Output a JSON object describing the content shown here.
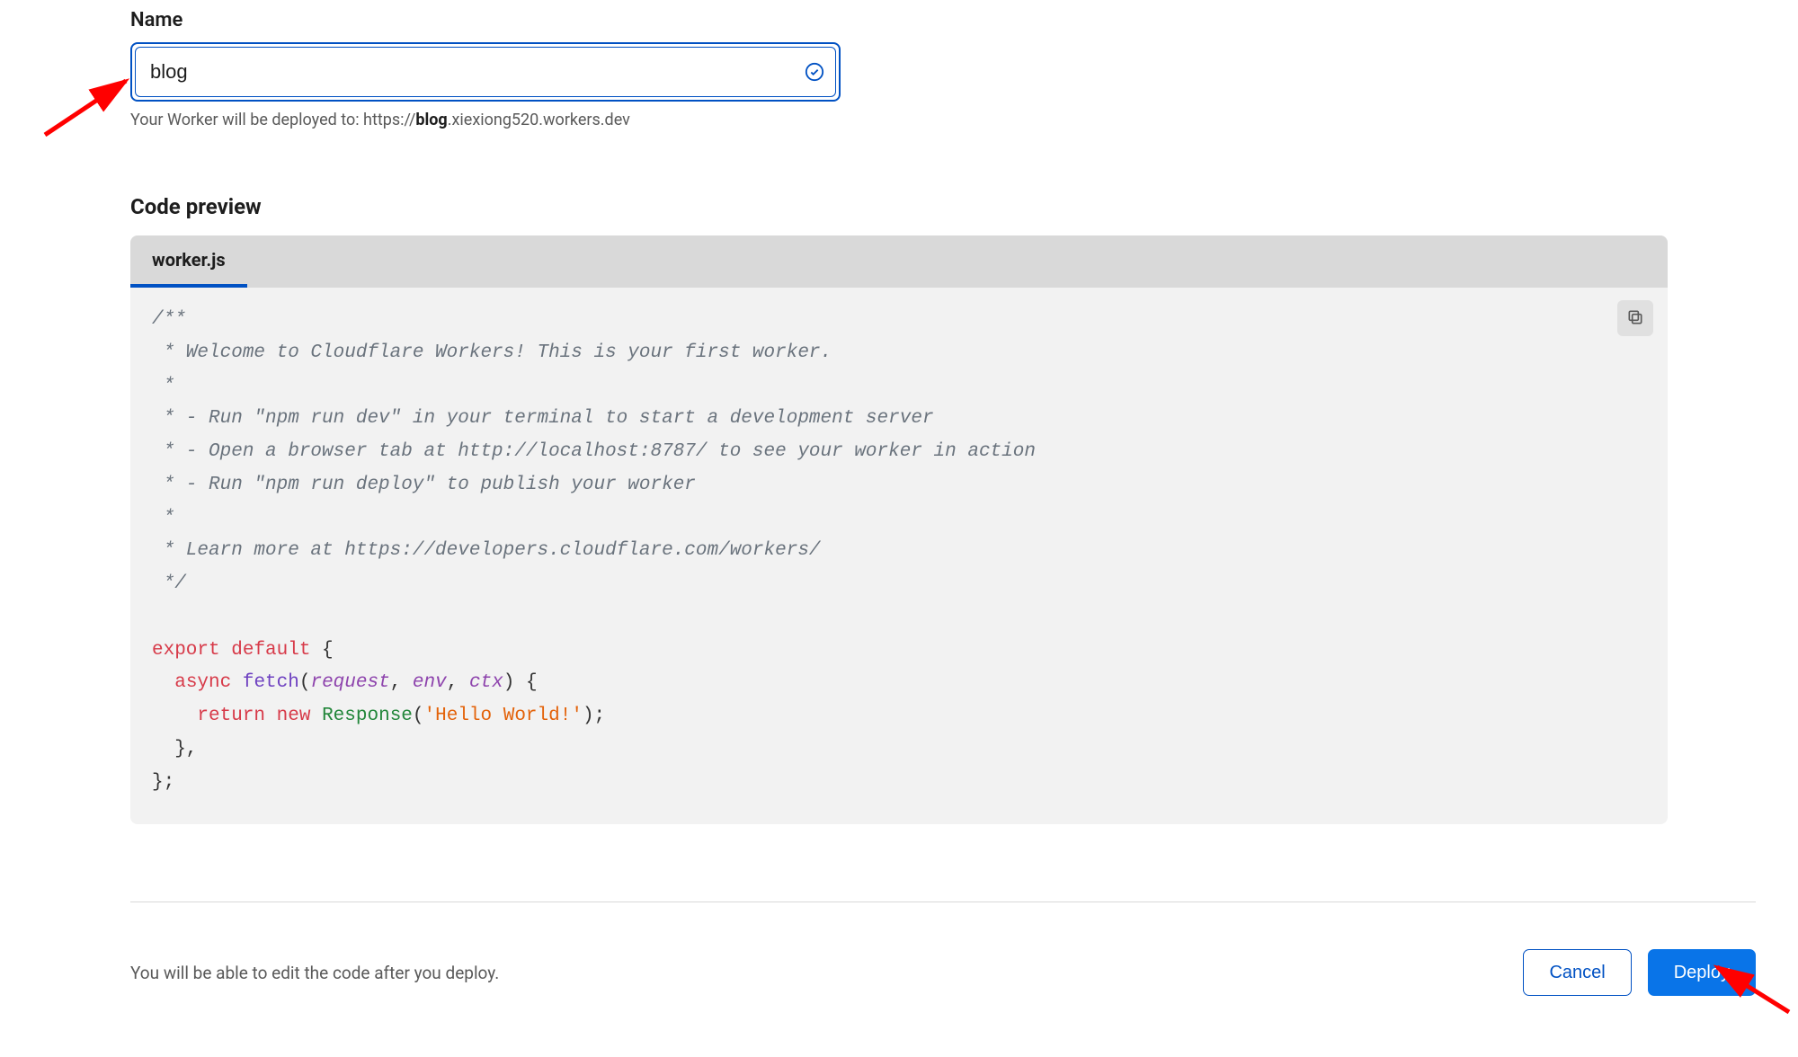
{
  "nameField": {
    "label": "Name",
    "value": "blog",
    "helperPrefix": "Your Worker will be deployed to: https://",
    "helperBold": "blog",
    "helperSuffix": ".xiexiong520.workers.dev"
  },
  "codePreview": {
    "heading": "Code preview",
    "tabLabel": "worker.js",
    "code": {
      "c1": "/**",
      "c2": " * Welcome to Cloudflare Workers! This is your first worker.",
      "c3": " *",
      "c4": " * - Run \"npm run dev\" in your terminal to start a development server",
      "c5": " * - Open a browser tab at http://localhost:8787/ to see your worker in action",
      "c6": " * - Run \"npm run deploy\" to publish your worker",
      "c7": " *",
      "c8": " * Learn more at https://developers.cloudflare.com/workers/",
      "c9": " */",
      "k_export": "export",
      "k_default": "default",
      "k_async": "async",
      "fn_fetch": "fetch",
      "p_request": "request",
      "p_env": "env",
      "p_ctx": "ctx",
      "k_return": "return",
      "k_new": "new",
      "cls_response": "Response",
      "str_hello": "'Hello World!'"
    }
  },
  "footer": {
    "note": "You will be able to edit the code after you deploy.",
    "cancel": "Cancel",
    "deploy": "Deploy"
  }
}
